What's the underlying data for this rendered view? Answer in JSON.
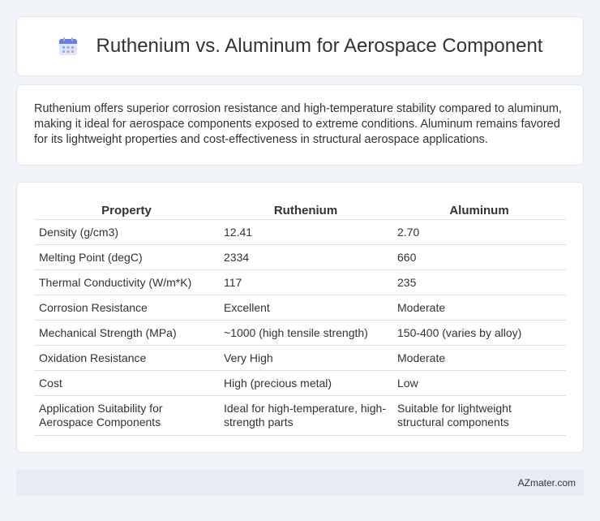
{
  "header": {
    "title": "Ruthenium vs. Aluminum for Aerospace Component",
    "icon": "calendar-icon"
  },
  "intro": {
    "text": "Ruthenium offers superior corrosion resistance and high-temperature stability compared to aluminum, making it ideal for aerospace components exposed to extreme conditions. Aluminum remains favored for its lightweight properties and cost-effectiveness in structural aerospace applications."
  },
  "table": {
    "headers": [
      "Property",
      "Ruthenium",
      "Aluminum"
    ],
    "rows": [
      [
        "Density (g/cm3)",
        "12.41",
        "2.70"
      ],
      [
        "Melting Point (degC)",
        "2334",
        "660"
      ],
      [
        "Thermal Conductivity (W/m*K)",
        "117",
        "235"
      ],
      [
        "Corrosion Resistance",
        "Excellent",
        "Moderate"
      ],
      [
        "Mechanical Strength (MPa)",
        "~1000 (high tensile strength)",
        "150-400 (varies by alloy)"
      ],
      [
        "Oxidation Resistance",
        "Very High",
        "Moderate"
      ],
      [
        "Cost",
        "High (precious metal)",
        "Low"
      ],
      [
        "Application Suitability for Aerospace Components",
        "Ideal for high-temperature, high-strength parts",
        "Suitable for lightweight structural components"
      ]
    ]
  },
  "footer": {
    "site": "AZmater.com"
  }
}
